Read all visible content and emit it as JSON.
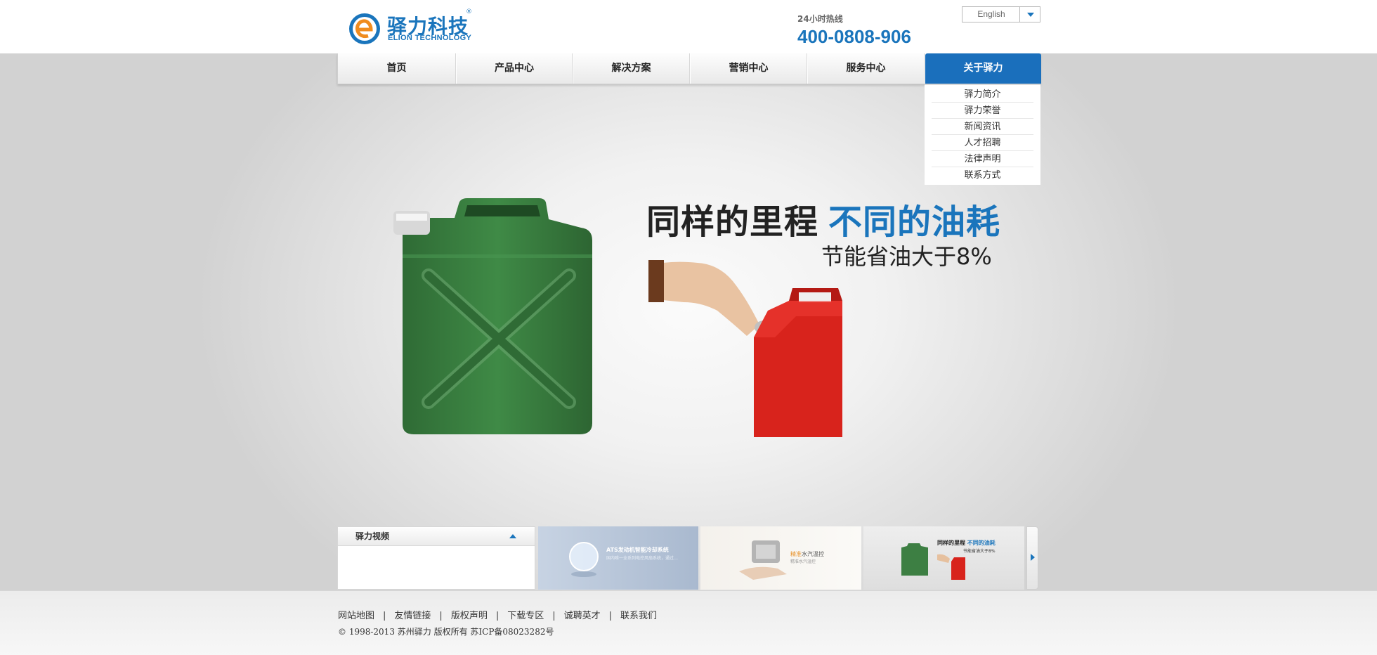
{
  "header": {
    "logo_cn": "驿力科技",
    "logo_reg": "®",
    "logo_en": "ELION TECHNOLOGY",
    "hotline_label": "24小时热线",
    "hotline_number": "400-0808-906",
    "language": "English"
  },
  "nav": {
    "items": [
      {
        "label": "首页"
      },
      {
        "label": "产品中心"
      },
      {
        "label": "解决方案"
      },
      {
        "label": "营销中心"
      },
      {
        "label": "服务中心"
      },
      {
        "label": "关于驿力"
      }
    ],
    "active": "关于驿力",
    "dropdown": [
      "驿力简介",
      "驿力荣誉",
      "新闻资讯",
      "人才招聘",
      "法律声明",
      "联系方式"
    ]
  },
  "banner": {
    "slogan_main": "同样的里程",
    "slogan_blue": "不同的油耗",
    "slogan_sub": "节能省油大于8%"
  },
  "video_panel": {
    "title": "驿力视频"
  },
  "thumbnails": [
    {
      "title": "ATS发动机智能冷却系统",
      "subtitle": "国内唯一全系列电控风扇系统，通过…"
    },
    {
      "title_orange": "精准",
      "title": "水汽温控",
      "subtitle": "精准水汽温控"
    },
    {
      "title_main": "同样的里程",
      "title_blue": "不同的油耗",
      "subtitle": "节能省油大于8%"
    }
  ],
  "footer": {
    "links": [
      "网站地图",
      "友情链接",
      "版权声明",
      "下载专区",
      "诚聘英才",
      "联系我们"
    ],
    "copyright": "© 1998-2013 苏州驿力 版权所有 苏ICP备08023282号"
  },
  "colors": {
    "brand_blue": "#1a75bc",
    "nav_active": "#1a6fbc"
  }
}
